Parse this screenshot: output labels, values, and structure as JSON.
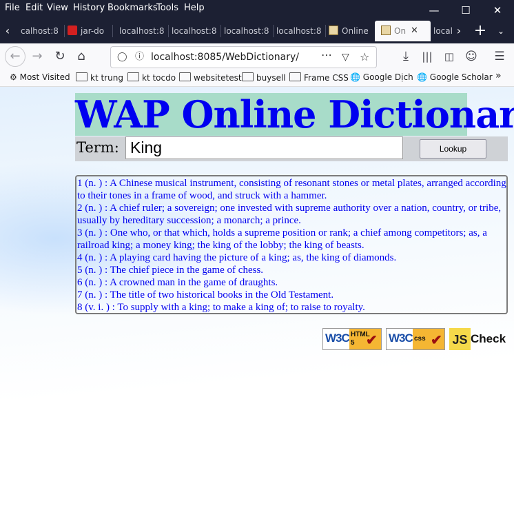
{
  "menu": [
    "File",
    "Edit",
    "View",
    "History",
    "Bookmarks",
    "Tools",
    "Help"
  ],
  "tabs": [
    {
      "label": "calhost:8"
    },
    {
      "label": "jar-do"
    },
    {
      "label": "localhost:8"
    },
    {
      "label": "localhost:8"
    },
    {
      "label": "localhost:8"
    },
    {
      "label": "localhost:8"
    },
    {
      "label": "Online"
    },
    {
      "label": "On"
    },
    {
      "label": "local"
    }
  ],
  "url": "localhost:8085/WebDictionary/",
  "bookmarks": [
    "Most Visited",
    "kt trung",
    "kt tocdo",
    "websitetest",
    "buysell",
    "Frame CSS",
    "Google Dịch",
    "Google Scholar"
  ],
  "page": {
    "title": "WAP Online Dictionary",
    "term_label": "Term:",
    "term_value": "King",
    "lookup_label": "Lookup",
    "definitions": [
      "1 (n. ) : A Chinese musical instrument, consisting of resonant stones or metal plates, arranged according to their tones in a frame of wood, and struck with a hammer.",
      "2 (n. ) : A chief ruler; a sovereign; one invested with supreme authority over a nation, country, or tribe, usually by hereditary succession; a monarch; a prince.",
      "3 (n. ) : One who, or that which, holds a supreme position or rank; a chief among competitors; as, a railroad king; a money king; the king of the lobby; the king of beasts.",
      "4 (n. ) : A playing card having the picture of a king; as, the king of diamonds.",
      "5 (n. ) : The chief piece in the game of chess.",
      "6 (n. ) : A crowned man in the game of draughts.",
      "7 (n. ) : The title of two historical books in the Old Testament.",
      "8 (v. i. ) : To supply with a king; to make a king of; to raise to royalty."
    ],
    "badges": {
      "html_badge_w3c": "W3C",
      "html_badge_label": "HTML",
      "html_badge_version": "5",
      "css_badge_w3c": "W3C",
      "css_badge_label": "css",
      "js_badge_js": "JS",
      "js_badge_label": "Check"
    }
  },
  "colors": {
    "title_bg": "#a8dcc9",
    "title_text": "#0000f0",
    "definition_text": "#0000ee",
    "search_row_bg": "#cfd2d6",
    "chrome_dark": "#1c2033"
  }
}
